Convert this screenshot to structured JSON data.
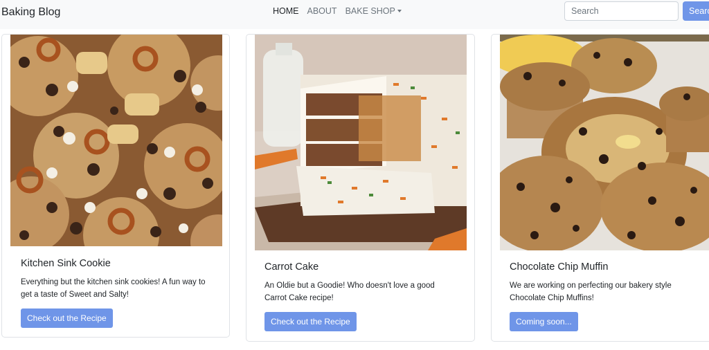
{
  "navbar": {
    "brand": "Baking Blog",
    "links": [
      {
        "label": "HOME"
      },
      {
        "label": "ABOUT"
      },
      {
        "label": "BAKE SHOP"
      }
    ],
    "search": {
      "placeholder": "Search",
      "button_label": "Search"
    }
  },
  "cards": [
    {
      "title": "Kitchen Sink Cookie",
      "text": "Everything but the kitchen sink cookies! A fun way to get a taste of Sweet and Salty!",
      "button": "Check out the Recipe"
    },
    {
      "title": "Carrot Cake",
      "text": "An Oldie but a Goodie! Who doesn't love a good Carrot Cake recipe!",
      "button": "Check out the Recipe"
    },
    {
      "title": "Chocolate Chip Muffin",
      "text": "We are working on perfecting our bakery style Chocolate Chip Muffins!",
      "button": "Coming soon..."
    }
  ],
  "colors": {
    "primary": "#6f95e8",
    "navbar_bg": "#f8f9fa"
  }
}
